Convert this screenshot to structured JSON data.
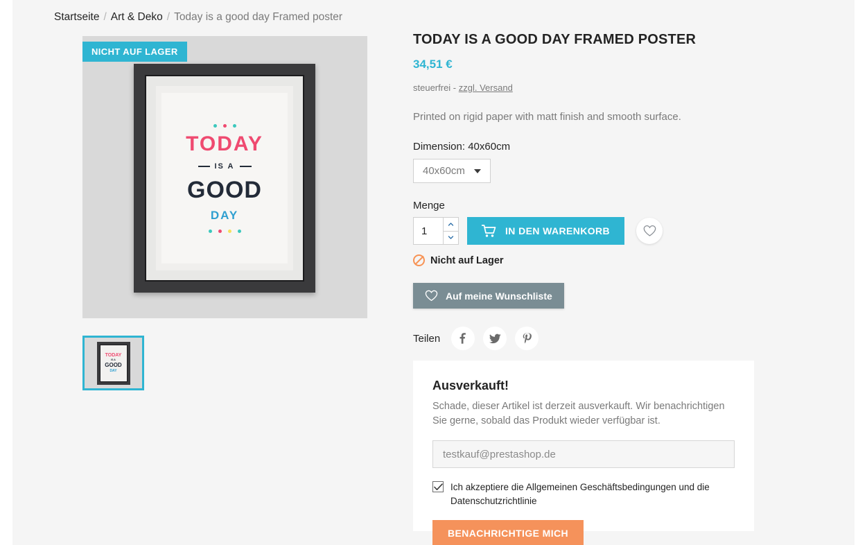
{
  "breadcrumb": {
    "home": "Startseite",
    "category": "Art & Deko",
    "current": "Today is a good day Framed poster",
    "separator": "/"
  },
  "gallery": {
    "stock_badge": "NICHT AUF LAGER",
    "poster": {
      "line1": "TODAY",
      "line2": "IS A",
      "line3": "GOOD",
      "line4": "DAY"
    }
  },
  "product": {
    "title": "TODAY IS A GOOD DAY FRAMED POSTER",
    "price": "34,51 €",
    "tax_prefix": "steuerfrei - ",
    "shipping_link": "zzgl. Versand",
    "description": "Printed on rigid paper with matt finish and smooth surface."
  },
  "dimension": {
    "label": "Dimension: 40x60cm",
    "selected": "40x60cm"
  },
  "quantity": {
    "label": "Menge",
    "value": "1"
  },
  "actions": {
    "add_to_cart": "IN DEN WARENKORB",
    "wishlist": "Auf meine Wunschliste",
    "stock_status": "Nicht auf Lager"
  },
  "share": {
    "label": "Teilen",
    "networks": [
      "facebook",
      "twitter",
      "pinterest"
    ]
  },
  "notify": {
    "title": "Ausverkauft!",
    "description": "Schade, dieser Artikel ist derzeit ausverkauft. Wir benachrichtigen Sie gerne, sobald das Produkt wieder verfügbar ist.",
    "email_placeholder": "testkauf@prestashop.de",
    "terms": "Ich akzeptiere die Allgemeinen Geschäftsbedingungen und die Datenschutzrichtlinie",
    "terms_checked": true,
    "button": "BENACHRICHTIGE MICH"
  },
  "colors": {
    "accent": "#2fb5d2",
    "orange": "#f5925b",
    "wishlist": "#7a8d94",
    "pink": "#ef4a70",
    "dark": "#232b38",
    "blue": "#2f9fd0",
    "page_bg": "#f5f5f5"
  }
}
